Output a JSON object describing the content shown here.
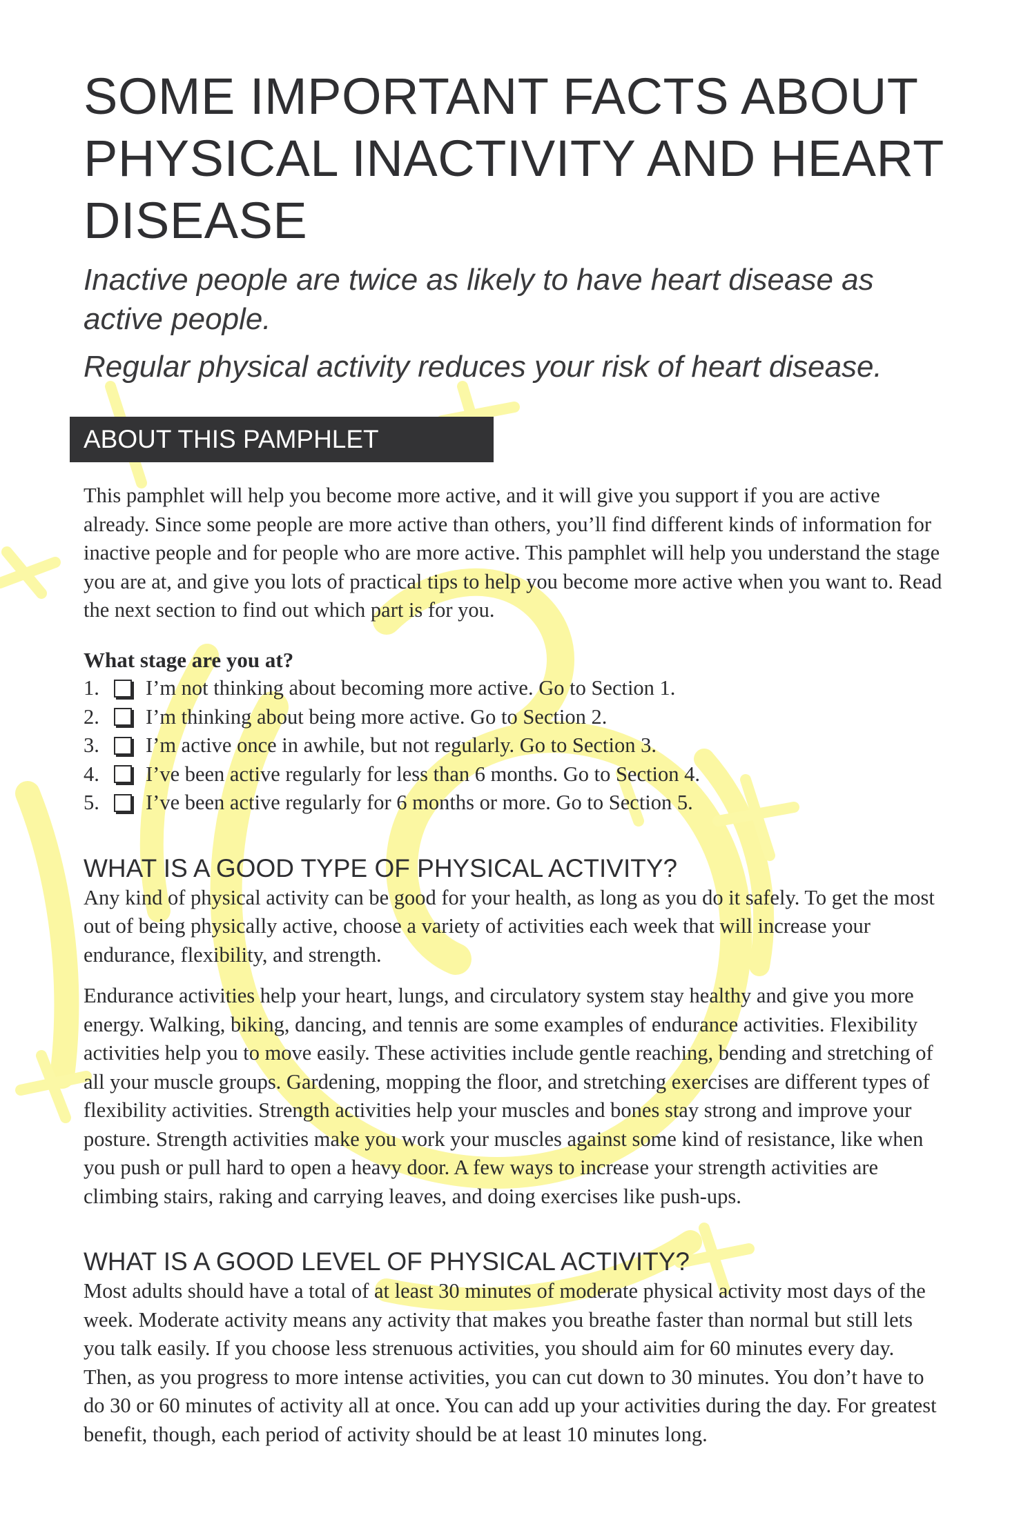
{
  "title": "SOME IMPORTANT FACTS ABOUT PHYSICAL INACTIVITY AND HEART DISEASE",
  "subtitles": [
    "Inactive people are twice as likely to have heart disease as active people.",
    "Regular physical activity reduces your risk of heart disease."
  ],
  "about": {
    "heading": "ABOUT THIS PAMPHLET",
    "text": "This pamphlet will help you become more active, and it will give you support if you are active already. Since some people are more active than others, you’ll find different kinds of information for inactive people and for people who are more active. This pamphlet will help you understand the stage you are at, and give you lots of practical tips to help you become more active when you want to. Read the next section to find out which part is for you."
  },
  "stage_question": "What stage are you at?",
  "stages": [
    {
      "number": "1.",
      "text": "I’m not thinking about becoming more active. Go to Section 1."
    },
    {
      "number": "2.",
      "text": "I’m thinking about being more active. Go to Section 2."
    },
    {
      "number": "3.",
      "text": "I’m active once in awhile, but not regularly. Go to Section 3."
    },
    {
      "number": "4.",
      "text": "I’ve been active regularly for less than 6 months. Go to Section 4."
    },
    {
      "number": "5.",
      "text": "I’ve been active regularly for 6 months or more. Go to Section 5."
    }
  ],
  "good_type": {
    "heading": "WHAT IS A GOOD TYPE OF PHYSICAL ACTIVITY?",
    "para1": "Any kind of physical activity can be good for your health, as long as you do it safely. To get the most out of being physically active, choose a variety of activities each week that will increase your endurance, flexibility, and strength.",
    "para2": "Endurance activities help your heart, lungs, and circulatory system stay healthy and give you more energy. Walking, biking, dancing, and tennis are some examples of endurance activities. Flexibility activities help you to move easily. These activities include gentle reaching, bending and stretching of all your muscle groups. Gardening, mopping the floor, and stretching exercises are different types of flexibility activities. Strength activities help your muscles and bones stay strong and improve your posture. Strength activities make you work your muscles against some kind of resistance, like when you push or pull hard to open a heavy door. A few ways to increase your strength activities are climbing stairs, raking and carrying leaves, and doing exercises like push-ups."
  },
  "good_level": {
    "heading": "WHAT IS A GOOD LEVEL OF PHYSICAL ACTIVITY?",
    "text": "Most adults should have a total of at least 30 minutes of moderate physical activity most days of the week. Moderate activity means any activity that makes you breathe faster than normal but still lets you talk easily. If you choose less strenuous activities, you should aim for 60 minutes every day. Then, as you progress to more intense activities, you can cut down to 30 minutes. You don’t have to do 30 or 60 minutes of activity all at once. You can add up your activities during the day. For greatest benefit, though, each period of activity should be at least 10 minutes long."
  },
  "colors": {
    "text": "#2b2b2d",
    "bar": "#333335",
    "watermark": "#fbf8a6"
  }
}
